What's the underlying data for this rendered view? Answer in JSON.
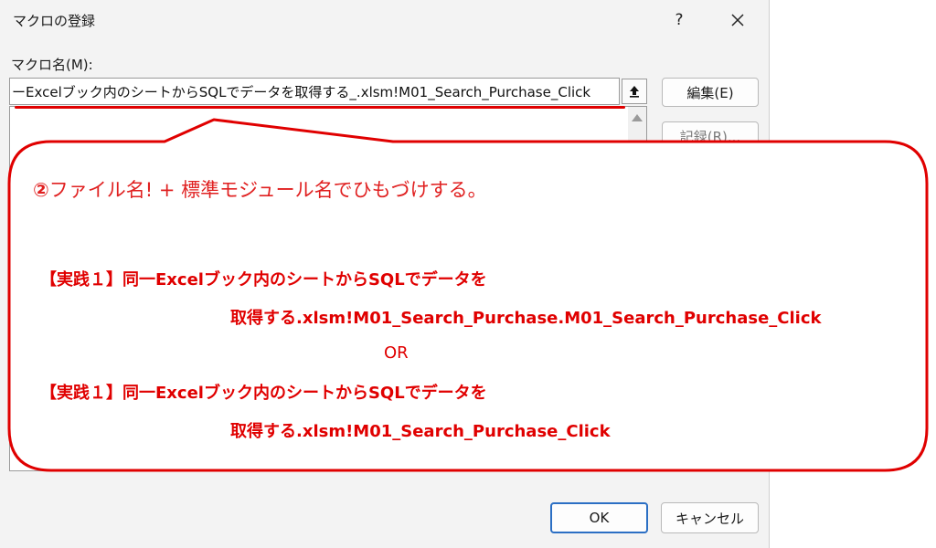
{
  "dialog": {
    "title": "マクロの登録",
    "help_label": "?",
    "close_icon": "close-icon",
    "field_label": "マクロ名(M):",
    "macro_name_value": "ーExcelブック内のシートからSQLでデータを取得する_.xlsm!M01_Search_Purchase_Click",
    "upload_icon": "upload-arrow-icon",
    "buttons": {
      "edit": "編集(E)",
      "record": "記録(R)...",
      "ok": "OK",
      "cancel": "キャンセル"
    }
  },
  "callout": {
    "heading_number": "②",
    "heading": "ファイル名! + 標準モジュール名でひもづけする。",
    "example1_line1": "【実践１】同一Excelブック内のシートからSQLでデータを",
    "example1_line2": "取得する.xlsm!M01_Search_Purchase.M01_Search_Purchase_Click",
    "or_text": "OR",
    "example2_line1": "【実践１】同一Excelブック内のシートからSQLでデータを",
    "example2_line2": "取得する.xlsm!M01_Search_Purchase_Click",
    "accent_color": "#e00000"
  }
}
